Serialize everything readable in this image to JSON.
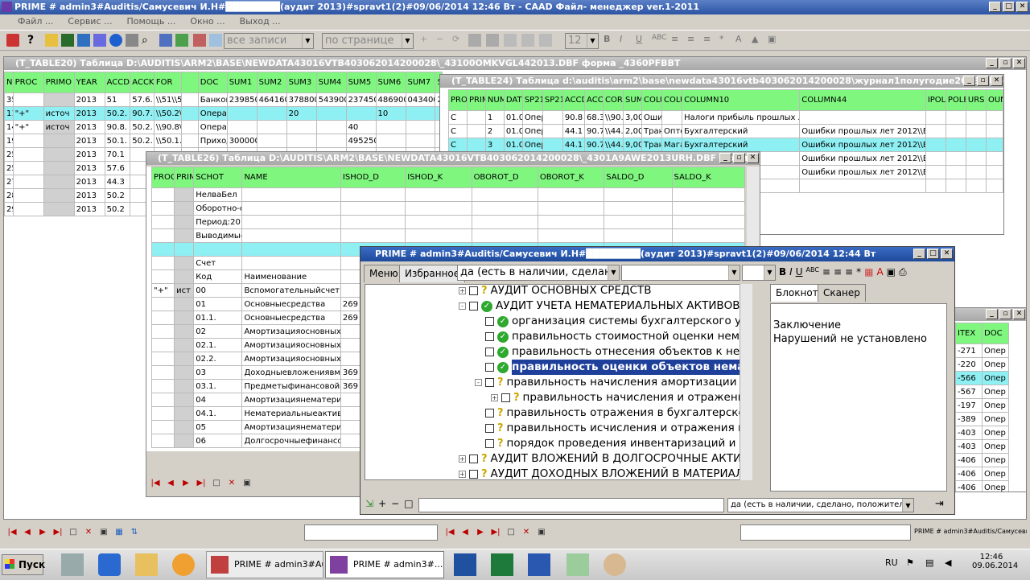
{
  "app": {
    "title": "PRIME # admin3#Auditis/Самусевич И.Н#████████(аудит 2013)#spravt1(2)#09/06/2014 12:46 Вт - САAD Файл- менеджер ver.1-2011"
  },
  "menu": [
    "Файл ...",
    "Сервис ...",
    "Помощь ...",
    "Окно ...",
    "Выход ..."
  ],
  "toolbar": {
    "filter_combo": "все записи",
    "page_combo": "по странице",
    "font_size": "12"
  },
  "t20": {
    "title": "(T_TABLE20) Таблица D:\\AUDITIS\\ARM2\\BASE\\NEWDATA43016VTB403062014200028\\_43100OMKVGL442013.DBF форма _4360PFBBT",
    "headers": [
      "NUM",
      "PROC",
      "PRIMO",
      "YEAR",
      "ACCDTID",
      "ACCKTID",
      "FOR",
      "",
      "DOC",
      "SUM1",
      "SUM2",
      "SUM3",
      "SUM4",
      "SUM5",
      "SUM6",
      "SUM7",
      "SU"
    ],
    "rows": [
      [
        "35",
        "",
        "",
        "2013",
        "51",
        "57.6.",
        "\\\\51\\\\57",
        "",
        "Банков",
        "239850",
        "464160",
        "378800",
        "543900",
        "237450",
        "486900",
        "043400",
        "29"
      ],
      [
        "116",
        "\"+\"",
        "источ",
        "2013",
        "50.2.",
        "90.7.",
        "\\\\50.2\\\\",
        "",
        "Операц",
        "",
        "",
        "20",
        "",
        "",
        "10",
        "",
        ""
      ],
      [
        "144",
        "\"+\"",
        "источ",
        "2013",
        "90.8.",
        "50.2.",
        "\\\\90.8\\\\",
        "",
        "Операц",
        "",
        "",
        "",
        "",
        "40",
        "",
        "",
        ""
      ],
      [
        "195",
        "",
        "",
        "2013",
        "50.1.",
        "50.2.",
        "\\\\50.1.\\\\",
        "",
        "Приход",
        "300000",
        "",
        "",
        "",
        "495250",
        "",
        "",
        ""
      ],
      [
        "252",
        "",
        "",
        "2013",
        "70.1",
        "",
        "",
        "",
        "",
        "",
        "",
        "",
        "",
        "",
        "",
        "",
        ""
      ],
      [
        "253",
        "",
        "",
        "2013",
        "57.6",
        "",
        "",
        "",
        "",
        "",
        "",
        "",
        "",
        "",
        "",
        "",
        ""
      ],
      [
        "277",
        "",
        "",
        "2013",
        "44.3",
        "",
        "",
        "",
        "",
        "",
        "",
        "",
        "",
        "",
        "",
        "",
        ""
      ],
      [
        "289",
        "",
        "",
        "2013",
        "50.2",
        "",
        "",
        "",
        "",
        "",
        "",
        "",
        "",
        "",
        "",
        "",
        ""
      ],
      [
        "290",
        "",
        "",
        "2013",
        "50.2",
        "",
        "",
        "",
        "",
        "",
        "",
        "",
        "",
        "",
        "",
        "",
        ""
      ]
    ]
  },
  "t24": {
    "title": "(T_TABLE24) Таблица d:\\auditis\\arm2\\base\\newdata43016vtb403062014200028\\журнал1полугодие2013.dbf форма _4360",
    "headers": [
      "PROC",
      "PRIMO",
      "NUM",
      "DATE",
      "SP211",
      "SP212",
      "ACCDT",
      "ACCKT",
      "CORR",
      "SUM",
      "COLUM",
      "COLUM",
      "COLUMN10",
      "COLUMN44",
      "IPOL",
      "POLE",
      "URS",
      "OUN"
    ],
    "rows": [
      [
        "С",
        "",
        "1",
        "01.0",
        "Опер",
        "",
        "90.8",
        "68.3",
        "\\\\90.8",
        "3,00",
        "Оши",
        "",
        "Налоги прибыль прошлых лет",
        "",
        "",
        "",
        "",
        ""
      ],
      [
        "С",
        "",
        "2",
        "01.0",
        "Опер",
        "",
        "44.1",
        "90.7",
        "\\\\44.",
        "2,00",
        "Тран",
        "Опто",
        "Бухгалтерский",
        "Ошибки прошлых лет 2012\\\\Без НДС",
        "",
        "",
        "",
        ""
      ],
      [
        "С",
        "",
        "3",
        "01.0",
        "Опер",
        "",
        "44.1",
        "90.7",
        "\\\\44.",
        "9,00",
        "Тран",
        "Мага",
        "Бухгалтерский",
        "Ошибки прошлых лет 2012\\\\Без НДС",
        "",
        "",
        "",
        ""
      ],
      [
        "",
        "",
        "",
        "",
        "",
        "",
        "",
        "",
        "",
        "",
        "",
        "",
        "",
        "Ошибки прошлых лет 2012\\\\Без НДС",
        "",
        "",
        "",
        ""
      ],
      [
        "",
        "",
        "",
        "",
        "",
        "",
        "",
        "",
        "",
        "",
        "",
        "",
        "",
        "Ошибки прошлых лет 2012\\\\Без НДС",
        "",
        "",
        "",
        ""
      ],
      [
        "",
        "",
        "",
        "",
        "",
        "",
        "",
        "",
        "",
        "",
        "",
        "",
        "оловн",
        "",
        "",
        "",
        "",
        ""
      ]
    ]
  },
  "t26": {
    "title": "(T_TABLE26) Таблица D:\\AUDITIS\\ARM2\\BASE\\NEWDATA43016VTB403062014200028\\_4301A9AWE2013URH.DBF форма _4360P",
    "headers": [
      "PROC",
      "PRIMO",
      "SCHOT",
      "NAME",
      "ISHOD_D",
      "ISHOD_K",
      "OBOROT_D",
      "OBOROT_K",
      "SALDO_D",
      "SALDO_K"
    ],
    "rows": [
      [
        "",
        "",
        "НелваБел",
        "",
        "",
        "",
        "",
        "",
        "",
        ""
      ],
      [
        "",
        "",
        "Оборотно-с",
        "",
        "",
        "",
        "",
        "",
        "",
        ""
      ],
      [
        "",
        "",
        "Период:2013",
        "",
        "",
        "",
        "",
        "",
        "",
        ""
      ],
      [
        "",
        "",
        "Выводимые",
        "",
        "",
        "",
        "",
        "",
        "",
        ""
      ],
      [
        "",
        "",
        "",
        "",
        "",
        "",
        "",
        "",
        "",
        ""
      ],
      [
        "",
        "",
        "Счет",
        "",
        "",
        "",
        "",
        "",
        "",
        ""
      ],
      [
        "",
        "",
        "Код",
        "Наименование",
        "",
        "",
        "",
        "",
        "",
        ""
      ],
      [
        "\"+\"",
        "ист",
        "00",
        "Вспомогательныйсчет",
        "",
        "",
        "",
        "",
        "",
        ""
      ],
      [
        "",
        "",
        "01",
        "Основныесредства",
        "269",
        "",
        "",
        "",
        "",
        ""
      ],
      [
        "",
        "",
        "01.1.",
        "Основныесредства",
        "269",
        "",
        "",
        "",
        "",
        ""
      ],
      [
        "",
        "",
        "02",
        "Амортизацияосновныхс",
        "",
        "",
        "",
        "",
        "",
        ""
      ],
      [
        "",
        "",
        "02.1.",
        "Амортизацияосновныхс",
        "",
        "",
        "",
        "",
        "",
        ""
      ],
      [
        "",
        "",
        "02.2.",
        "Амортизацияосновныхс",
        "",
        "",
        "",
        "",
        "",
        ""
      ],
      [
        "",
        "",
        "03",
        "Доходныевложениявмат",
        "369",
        "",
        "",
        "",
        "",
        ""
      ],
      [
        "",
        "",
        "03.1.",
        "Предметыфинансовойар",
        "369",
        "",
        "",
        "",
        "",
        ""
      ],
      [
        "",
        "",
        "04",
        "Амортизациянематериа",
        "",
        "",
        "",
        "",
        "",
        ""
      ],
      [
        "",
        "",
        "04.1.",
        "Нематериальныеактивы",
        "",
        "",
        "",
        "",
        "",
        ""
      ],
      [
        "",
        "",
        "05",
        "Амортизациянематериа",
        "",
        "",
        "",
        "",
        "",
        ""
      ],
      [
        "",
        "",
        "06",
        "Долгосрочныефинансов",
        "",
        "",
        "",
        "",
        "",
        ""
      ]
    ]
  },
  "right_partial": {
    "headers": [
      "ITEX",
      "DOC"
    ],
    "rows": [
      [
        "-271",
        "Опер"
      ],
      [
        "-220",
        "Опер"
      ],
      [
        "-566",
        "Опер"
      ],
      [
        "-567",
        "Опер"
      ],
      [
        "-197",
        "Опер"
      ],
      [
        "-389",
        "Опер"
      ],
      [
        "-403",
        "Опер"
      ],
      [
        "-403",
        "Опер"
      ],
      [
        "-406",
        "Опер"
      ],
      [
        "-406",
        "Опер"
      ],
      [
        "-406",
        "Опер"
      ]
    ]
  },
  "prime": {
    "title": "PRIME # admin3#Auditis/Самусевич И.Н#████████(аудит 2013)#spravt1(2)#09/06/2014 12:44 Вт",
    "tabs": {
      "menu": "Меню",
      "fav": "Избранное"
    },
    "combo": "да (есть в наличии, сделано",
    "tree": [
      {
        "text": "АУДИТ ОСНОВНЫХ СРЕДСТВ",
        "level": 0,
        "icon": "q",
        "exp": "+"
      },
      {
        "text": "АУДИТ УЧЕТА НЕМАТЕРИАЛЬНЫХ АКТИВОВ.",
        "level": 0,
        "icon": "ok",
        "exp": "-"
      },
      {
        "text": "организация системы бухгалтерского учета и",
        "level": 1,
        "icon": "ok",
        "exp": ""
      },
      {
        "text": "правильность стоимостной оценки нематериа",
        "level": 1,
        "icon": "ok",
        "exp": ""
      },
      {
        "text": "правильность отнесения объектов к нематери",
        "level": 1,
        "icon": "ok",
        "exp": ""
      },
      {
        "text": "правильность оценки объектов нематериа",
        "level": 1,
        "icon": "ok",
        "exp": "",
        "selected": true
      },
      {
        "text": "правильность начисления амортизации по об",
        "level": 1,
        "icon": "q",
        "exp": "-"
      },
      {
        "text": "правильность начисления и отражения в бу",
        "level": 2,
        "icon": "q",
        "exp": "+"
      },
      {
        "text": "правильность отражения в бухгалтерском уче",
        "level": 1,
        "icon": "q",
        "exp": ""
      },
      {
        "text": "правильность исчисления и отражения в учет",
        "level": 1,
        "icon": "q",
        "exp": ""
      },
      {
        "text": "порядок проведения инвентаризаций и отраже",
        "level": 1,
        "icon": "q",
        "exp": ""
      },
      {
        "text": "АУДИТ ВЛОЖЕНИЙ В ДОЛГОСРОЧНЫЕ АКТИВЕ",
        "level": 0,
        "icon": "q",
        "exp": "+"
      },
      {
        "text": "АУДИТ ДОХОДНЫХ ВЛОЖЕНИЙ В МАТЕРИАЛЬ",
        "level": 0,
        "icon": "q",
        "exp": "+"
      }
    ],
    "note_tabs": {
      "notebook": "Блокнот",
      "scanner": "Сканер"
    },
    "note": {
      "line1": "Заключение",
      "line2": "Нарушений не установлено"
    },
    "bottom_combo": "да (есть в наличии, сделано, положительно"
  },
  "status_right": "PRIME # admin3#Auditis/Самусевич И.Н#",
  "taskbar": {
    "start": "Пуск",
    "btn1": "PRIME # admin3#Au...",
    "btn2": "PRIME # admin3#...",
    "lang": "RU",
    "time": "12:46",
    "date": "09.06.2014"
  }
}
